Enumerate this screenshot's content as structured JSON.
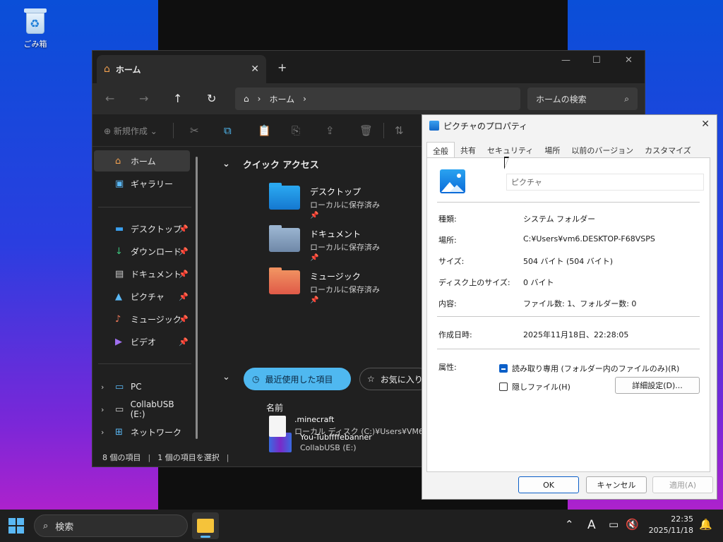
{
  "desktop": {
    "recycle_bin_label": "ごみ箱"
  },
  "explorer": {
    "tab_title": "ホーム",
    "address_segment": "ホーム",
    "search_placeholder": "ホームの検索",
    "toolbar": {
      "new_label": "新規作成"
    },
    "sidebar": {
      "home": "ホーム",
      "gallery": "ギャラリー",
      "desktop": "デスクトップ",
      "downloads": "ダウンロード",
      "documents": "ドキュメント",
      "pictures": "ピクチャ",
      "music": "ミュージック",
      "videos": "ビデオ",
      "pc": "PC",
      "usb": "CollabUSB (E:)",
      "network": "ネットワーク"
    },
    "quick_access_title": "クイック アクセス",
    "quick_access": [
      {
        "name": "デスクトップ",
        "sub": "ローカルに保存済み"
      },
      {
        "name": "ドキュメント",
        "sub": "ローカルに保存済み"
      },
      {
        "name": "ミュージック",
        "sub": "ローカルに保存済み"
      }
    ],
    "recent_pill": "最近使用した項目",
    "favorites_pill": "お気に入り",
    "column_name": "名前",
    "files": [
      {
        "name": "You-Tubffffebanner",
        "sub": "CollabUSB (E:)"
      },
      {
        "name": ".minecraft",
        "sub": "ローカル ディスク (C:)¥Users¥VM6.C..."
      }
    ],
    "status_items": "8 個の項目",
    "status_selected": "1 個の項目を選択",
    "accent": "#4fb8f0"
  },
  "dialog": {
    "title": "ピクチャのプロパティ",
    "tabs": [
      "全般",
      "共有",
      "セキュリティ",
      "場所",
      "以前のバージョン",
      "カスタマイズ"
    ],
    "name_value": "ピクチャ",
    "rows": [
      {
        "label": "種類:",
        "value": "システム フォルダー"
      },
      {
        "label": "場所:",
        "value": "C:¥Users¥vm6.DESKTOP-F68VSPS"
      },
      {
        "label": "サイズ:",
        "value": "504 バイト (504 バイト)"
      },
      {
        "label": "ディスク上のサイズ:",
        "value": "0 バイト"
      },
      {
        "label": "内容:",
        "value": "ファイル数: 1、フォルダー数: 0"
      },
      {
        "label": "作成日時:",
        "value": "2025年11月18日、22:28:05"
      }
    ],
    "attributes_label": "属性:",
    "readonly_label": "読み取り専用 (フォルダー内のファイルのみ)(R)",
    "hidden_label": "隠しファイル(H)",
    "advanced_label": "詳細設定(D)...",
    "ok_label": "OK",
    "cancel_label": "キャンセル",
    "apply_label": "適用(A)"
  },
  "taskbar": {
    "search_placeholder": "検索",
    "ime": "A",
    "time": "22:35",
    "date": "2025/11/18"
  }
}
